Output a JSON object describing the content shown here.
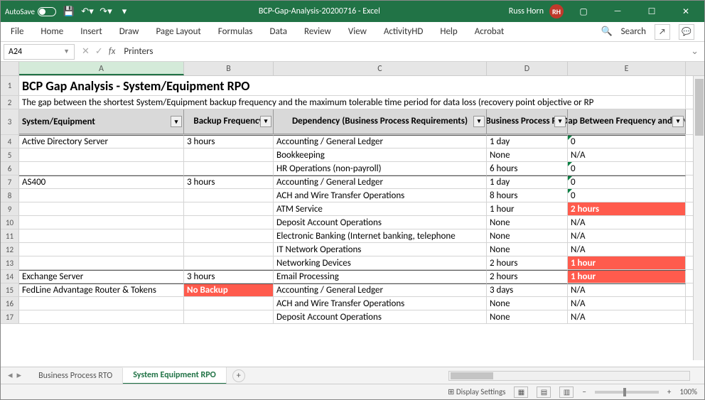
{
  "titlebar": {
    "autosave": "AutoSave",
    "filename": "BCP-Gap-Analysis-20200716  -  Excel",
    "user": "Russ Horn",
    "initials": "RH"
  },
  "ribbon": {
    "tabs": [
      "File",
      "Home",
      "Insert",
      "Draw",
      "Page Layout",
      "Formulas",
      "Data",
      "Review",
      "View",
      "ActivityHD",
      "Help",
      "Acrobat"
    ],
    "search": "Search"
  },
  "namebox": "A24",
  "formula": "Printers",
  "colLabels": [
    "A",
    "B",
    "C",
    "D",
    "E"
  ],
  "rows": [
    {
      "n": "1",
      "A": "BCP Gap Analysis - System/Equipment RPO"
    },
    {
      "n": "2",
      "merged": "The gap between the shortest System/Equipment backup frequency and the maximum tolerable time period for data loss (recovery point objective or RP"
    },
    {
      "n": "3",
      "A": "System/Equipment",
      "B": "Backup Frequency",
      "C": "Dependency (Business Process Requirements)",
      "D": "Business Process RPO",
      "E": "Gap Between Frequency and RPO"
    },
    {
      "n": "4",
      "A": "Active Directory Server",
      "B": "3 hours",
      "C": "Accounting / General Ledger",
      "D": "1 day",
      "E": "0"
    },
    {
      "n": "5",
      "A": "",
      "B": "",
      "C": "Bookkeeping",
      "D": "None",
      "E": "N/A"
    },
    {
      "n": "6",
      "A": "",
      "B": "",
      "C": "HR Operations (non-payroll)",
      "D": "6 hours",
      "E": "0"
    },
    {
      "n": "7",
      "A": "AS400",
      "B": "3 hours",
      "C": "Accounting / General Ledger",
      "D": "1 day",
      "E": "0"
    },
    {
      "n": "8",
      "A": "",
      "B": "",
      "C": "ACH and Wire Transfer Operations",
      "D": "8 hours",
      "E": "0"
    },
    {
      "n": "9",
      "A": "",
      "B": "",
      "C": "ATM Service",
      "D": "1 hour",
      "E": "2 hours"
    },
    {
      "n": "10",
      "A": "",
      "B": "",
      "C": "Deposit Account Operations",
      "D": "None",
      "E": "N/A"
    },
    {
      "n": "11",
      "A": "",
      "B": "",
      "C": "Electronic Banking (Internet banking, telephone",
      "D": "None",
      "E": "N/A"
    },
    {
      "n": "12",
      "A": "",
      "B": "",
      "C": "IT Network Operations",
      "D": "None",
      "E": "N/A"
    },
    {
      "n": "13",
      "A": "",
      "B": "",
      "C": "Networking Devices",
      "D": "2 hours",
      "E": "1 hour"
    },
    {
      "n": "14",
      "A": "Exchange Server",
      "B": "3 hours",
      "C": "Email Processing",
      "D": "2 hours",
      "E": "1 hour"
    },
    {
      "n": "15",
      "A": "FedLine Advantage Router & Tokens",
      "B": "No Backup",
      "C": "Accounting / General Ledger",
      "D": "3 days",
      "E": "N/A"
    },
    {
      "n": "16",
      "A": "",
      "B": "",
      "C": "ACH and Wire Transfer Operations",
      "D": "None",
      "E": "N/A"
    },
    {
      "n": "17",
      "A": "",
      "B": "",
      "C": "Deposit Account Operations",
      "D": "None",
      "E": "N/A"
    }
  ],
  "tabs": {
    "t1": "Business Process RTO",
    "t2": "System Equipment RPO"
  },
  "status": {
    "display": "Display Settings",
    "zoom": "100%"
  }
}
